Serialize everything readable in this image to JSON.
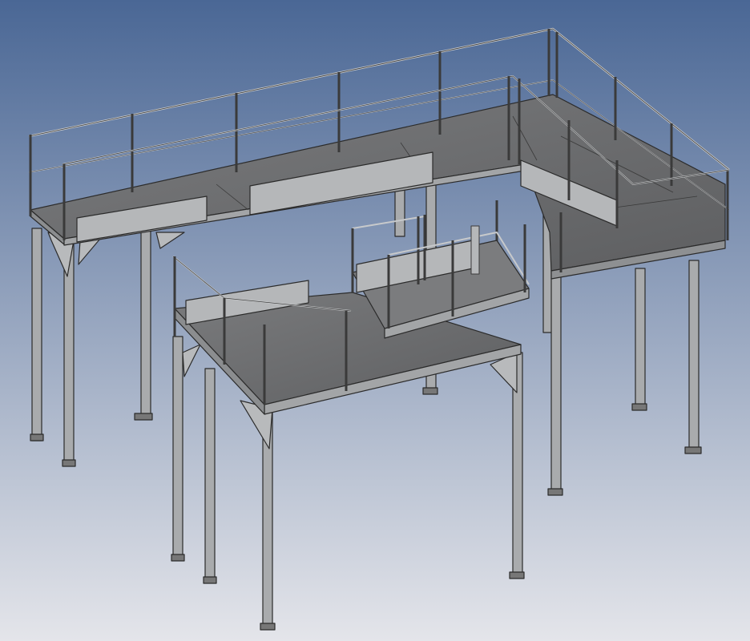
{
  "viewport": {
    "background_top": "#4a6795",
    "background_bottom": "#e4e5ea"
  },
  "model": {
    "steel_color": "#9c9ea0",
    "deck_color": "#6f7072",
    "edge_color": "#2b2b2b",
    "rail_color": "#bfc1c3"
  }
}
